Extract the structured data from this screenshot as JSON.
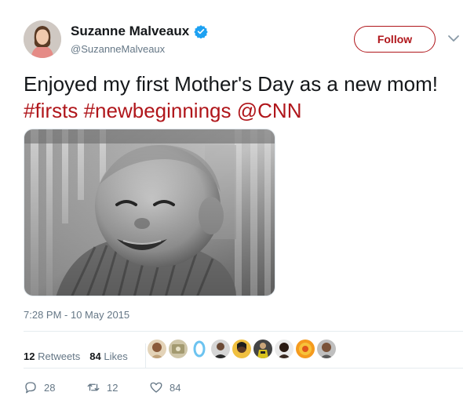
{
  "user": {
    "display_name": "Suzanne Malveaux",
    "handle": "@SuzanneMalveaux",
    "verified": true
  },
  "follow_button": {
    "label": "Follow"
  },
  "tweet": {
    "text": "Enjoyed my first Mother's Day as a new mom!",
    "tags": [
      "#firsts",
      "#newbeginnings",
      "@CNN"
    ],
    "timestamp": "7:28 PM - 10 May 2015"
  },
  "stats": {
    "retweets_count": "12",
    "retweets_label": "Retweets",
    "likes_count": "84",
    "likes_label": "Likes"
  },
  "actions": {
    "reply_count": "28",
    "retweet_count": "12",
    "like_count": "84"
  },
  "colors": {
    "accent": "#b0161b",
    "verified": "#1da1f2",
    "muted": "#657786"
  }
}
